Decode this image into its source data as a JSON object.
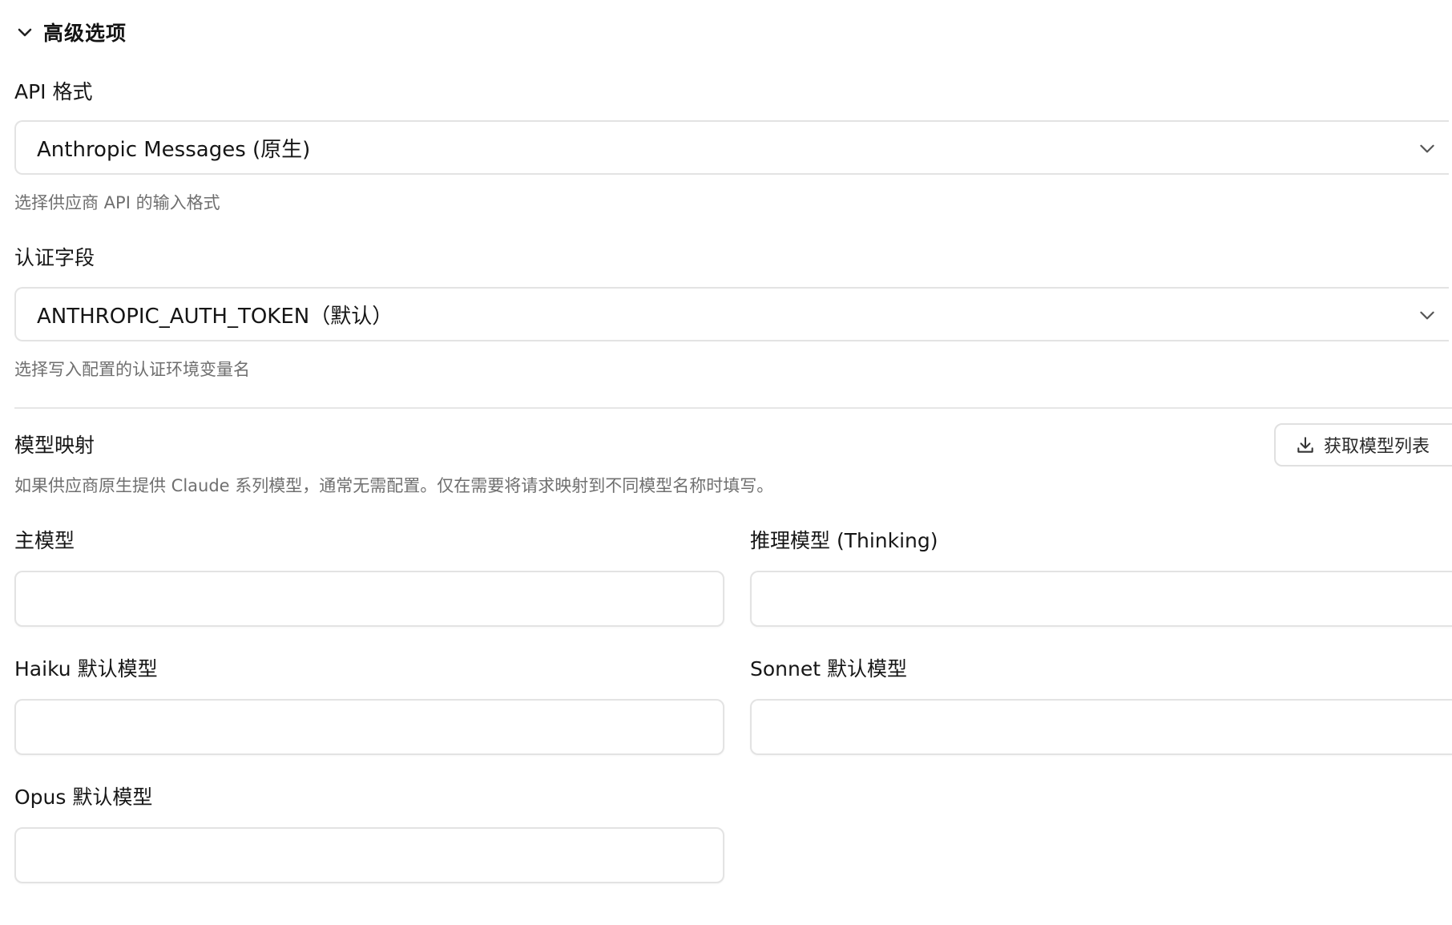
{
  "section": {
    "title": "高级选项",
    "expanded": true
  },
  "api_format": {
    "label": "API 格式",
    "value": "Anthropic Messages (原生)",
    "hint": "选择供应商 API 的输入格式"
  },
  "auth_field": {
    "label": "认证字段",
    "value": "ANTHROPIC_AUTH_TOKEN（默认）",
    "hint": "选择写入配置的认证环境变量名"
  },
  "model_mapping": {
    "title": "模型映射",
    "fetch_button_label": "获取模型列表",
    "description": "如果供应商原生提供 Claude 系列模型，通常无需配置。仅在需要将请求映射到不同模型名称时填写。",
    "fields": {
      "main_model": {
        "label": "主模型",
        "value": ""
      },
      "thinking_model": {
        "label": "推理模型 (Thinking)",
        "value": ""
      },
      "haiku_model": {
        "label": "Haiku 默认模型",
        "value": ""
      },
      "sonnet_model": {
        "label": "Sonnet 默认模型",
        "value": ""
      },
      "opus_model": {
        "label": "Opus 默认模型",
        "value": ""
      }
    }
  },
  "icons": {
    "section_toggle": "chevron-down-icon",
    "select_arrow": "chevron-down-icon",
    "fetch": "download-icon"
  }
}
